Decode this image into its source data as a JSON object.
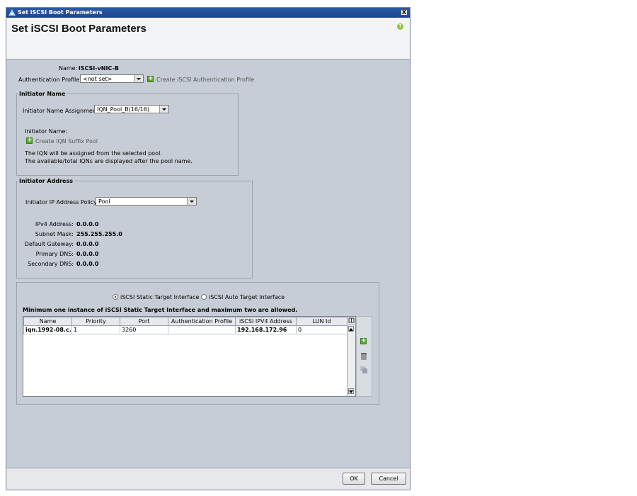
{
  "window": {
    "title": "Set iSCSI Boot Parameters",
    "close_glyph": "X"
  },
  "header": {
    "title": "Set iSCSI Boot Parameters",
    "help_glyph": "?"
  },
  "name": {
    "label": "Name:",
    "value": "iSCSI-vNIC-B"
  },
  "auth_profile": {
    "label": "Authentication Profile:",
    "value": "<not set>",
    "create_link": "Create iSCSI Authentication Profile"
  },
  "initiator_name": {
    "legend": "Initiator Name",
    "assignment_label": "Initiator Name Assignment:",
    "assignment_value": "IQN_Pool_B(16/16)",
    "name_label": "Initiator Name:",
    "create_link": "Create IQN Suffix Pool",
    "note_line1": "The IQN will be assigned from the selected pool.",
    "note_line2": "The available/total IQNs are displayed after the pool name."
  },
  "initiator_address": {
    "legend": "Initiator Address",
    "policy_label": "Initiator IP Address Policy:",
    "policy_value": "Pool",
    "ipv4_label": "IPv4 Address:",
    "ipv4_value": "0.0.0.0",
    "subnet_label": "Subnet Mask:",
    "subnet_value": "255.255.255.0",
    "gateway_label": "Default Gateway:",
    "gateway_value": "0.0.0.0",
    "pdns_label": "Primary DNS:",
    "pdns_value": "0.0.0.0",
    "sdns_label": "Secondary DNS:",
    "sdns_value": "0.0.0.0"
  },
  "target": {
    "static_label": "iSCSI Static Target Interface",
    "auto_label": "iSCSI Auto Target Interface",
    "selected": "static",
    "note": "Minimum one instance of iSCSI Static Target Interface and maximum two are allowed.",
    "columns": [
      "Name",
      "Priority",
      "Port",
      "Authentication Profile",
      "iSCSI IPV4 Address",
      "LUN Id"
    ],
    "rows": [
      [
        "iqn.1992-08.c...",
        "1",
        "3260",
        "",
        "192.168.172.96",
        "0"
      ]
    ]
  },
  "footer": {
    "ok_label": "OK",
    "cancel_label": "Cancel"
  },
  "colors": {
    "titlebar": "#1d4490",
    "body": "#c7cdd6",
    "add_green": "#5aa832"
  }
}
